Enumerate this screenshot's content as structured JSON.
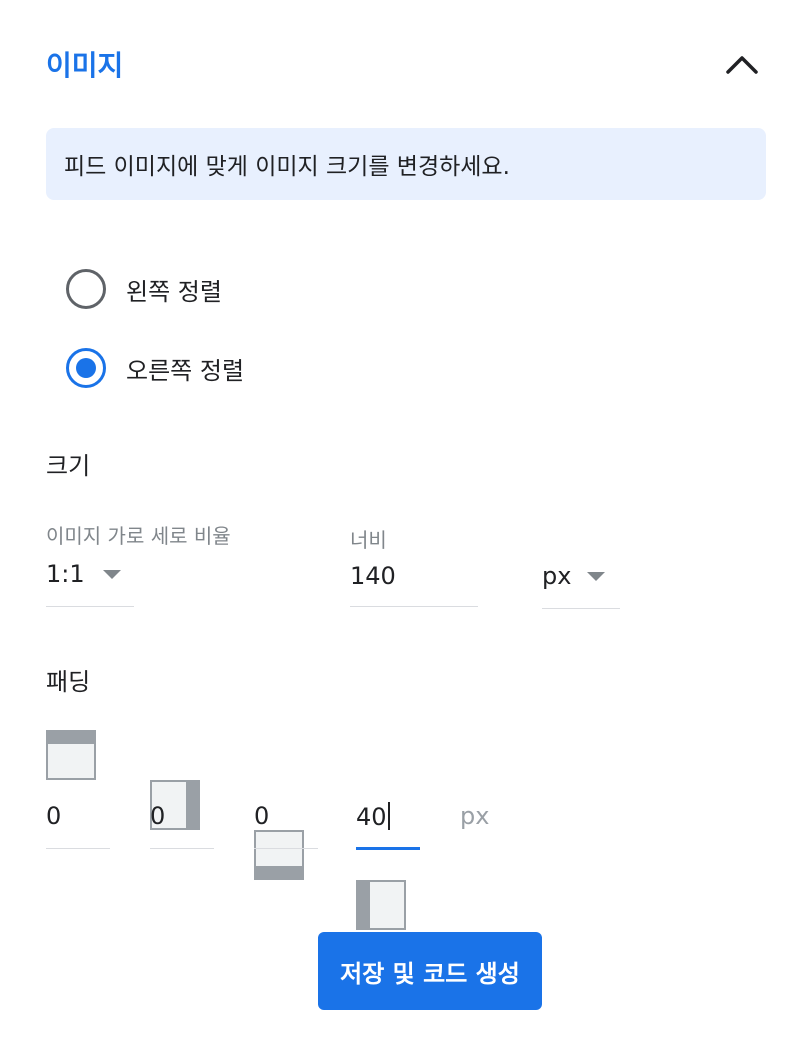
{
  "section": {
    "title": "이미지",
    "collapse_icon": "chevron-up-icon",
    "accent_color": "#1a73e8"
  },
  "info": {
    "text": "피드 이미지에 맞게 이미지 크기를 변경하세요.",
    "background": "#e8f0fe"
  },
  "alignment": {
    "options": [
      {
        "label": "왼쪽 정렬",
        "checked": false
      },
      {
        "label": "오른쪽 정렬",
        "checked": true
      }
    ]
  },
  "size": {
    "heading": "크기",
    "aspect_ratio": {
      "label": "이미지 가로 세로 비율",
      "value": "1:1"
    },
    "width": {
      "label": "너비",
      "value": "140"
    },
    "unit": {
      "value": "px"
    }
  },
  "padding": {
    "heading": "패딩",
    "fields": [
      {
        "icon": "padding-top-icon",
        "value": "0"
      },
      {
        "icon": "padding-right-icon",
        "value": "0"
      },
      {
        "icon": "padding-bottom-icon",
        "value": "0"
      },
      {
        "icon": "padding-left-icon",
        "value": "40",
        "focused": true
      }
    ],
    "unit": "px"
  },
  "actions": {
    "save_label": "저장 및 코드 생성"
  }
}
